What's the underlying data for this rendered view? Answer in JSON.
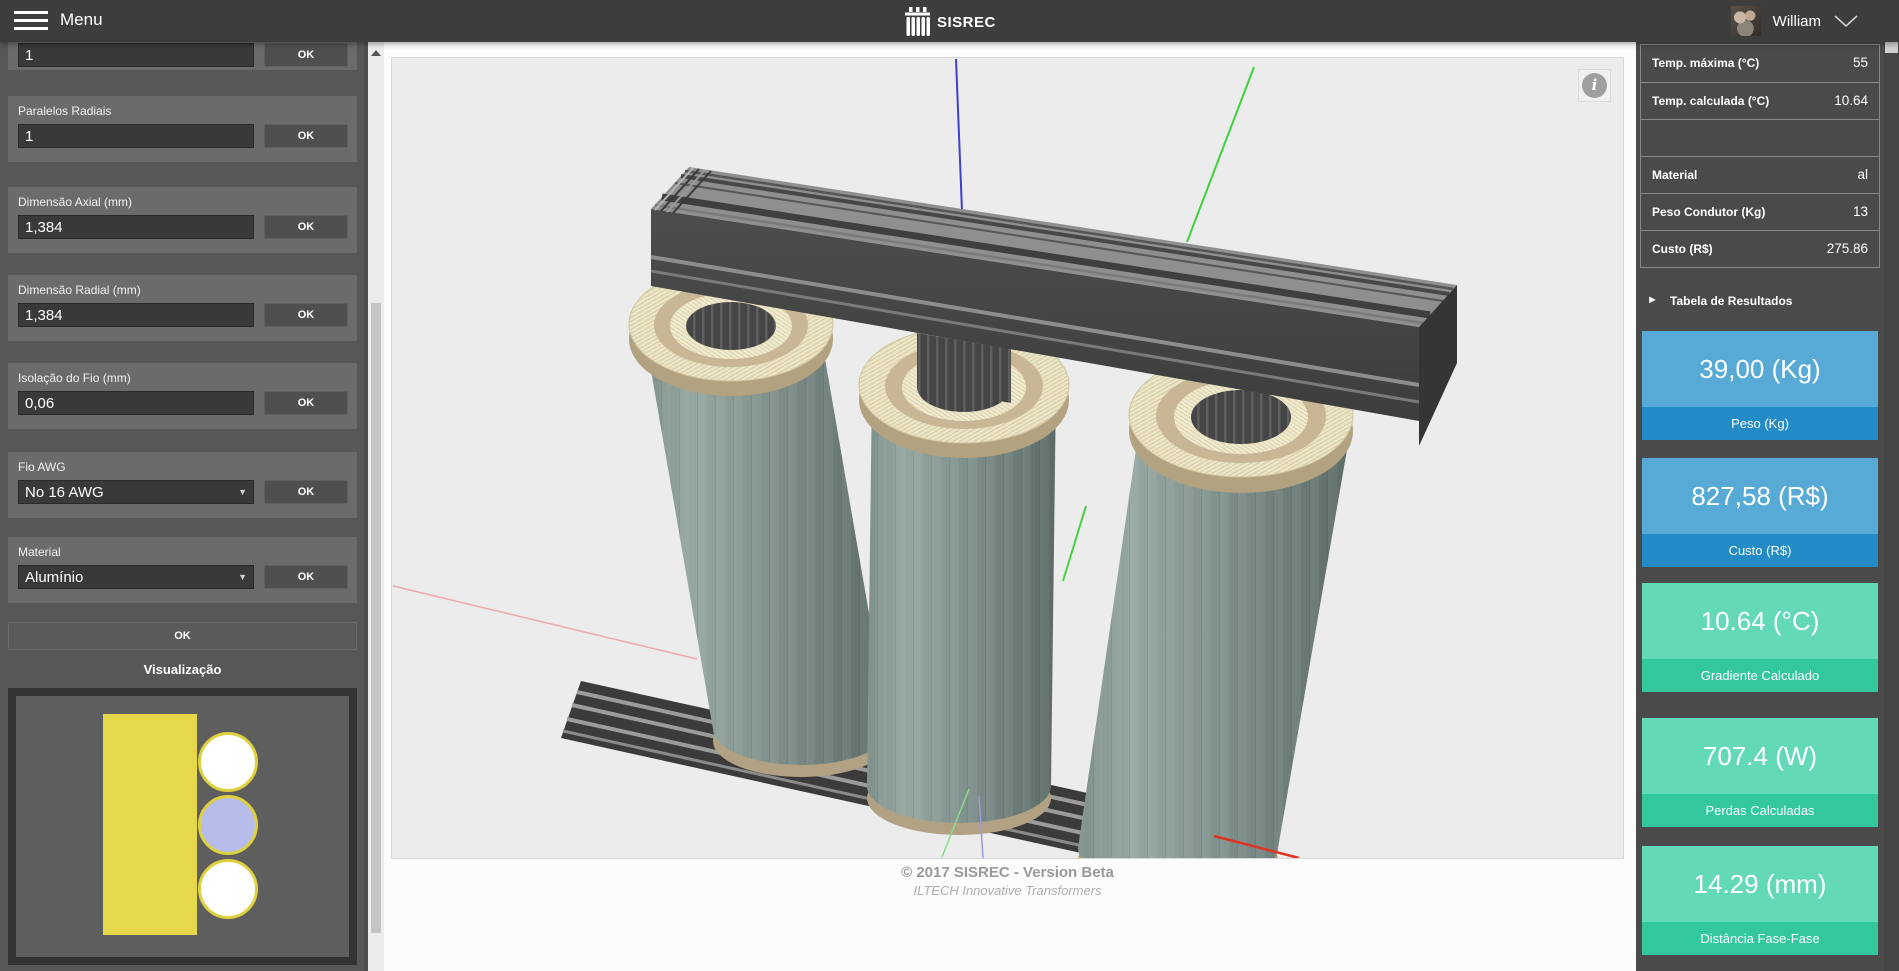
{
  "header": {
    "menu_label": "Menu",
    "app_name": "SISREC",
    "user_name": "William"
  },
  "icons": {
    "caret": "▼",
    "info": "i",
    "results_arrow": "►"
  },
  "sidebar": {
    "groups": [
      {
        "label": "",
        "value": "1"
      },
      {
        "label": "Paralelos Radiais",
        "value": "1"
      },
      {
        "label": "Dimensão Axial (mm)",
        "value": "1,384"
      },
      {
        "label": "Dimensão Radial (mm)",
        "value": "1,384"
      },
      {
        "label": "Isolação do Fio (mm)",
        "value": "0,06"
      },
      {
        "label": "Fio AWG",
        "value": "No 16 AWG"
      },
      {
        "label": "Material",
        "value": "Alumínio"
      }
    ],
    "ok_label": "OK",
    "visualization_title": "Visualização"
  },
  "canvas": {
    "footer_line1": "© 2017 SISREC - Version Beta",
    "footer_line2": "ILTECH Innovative Transformers"
  },
  "results": {
    "toggle_label": "Tabela de Resultados",
    "rows": [
      {
        "label": "Temp. máxima (°C)",
        "value": "55"
      },
      {
        "label": "Temp. calculada (°C)",
        "value": "10.64"
      },
      {
        "label": "",
        "value": ""
      },
      {
        "label": "Material",
        "value": "al"
      },
      {
        "label": "Peso Condutor (Kg)",
        "value": "13"
      },
      {
        "label": "Custo (R$)",
        "value": "275.86"
      }
    ],
    "cards": [
      {
        "value": "39,00 (Kg)",
        "label": "Peso (Kg)",
        "theme": "blue"
      },
      {
        "value": "827,58 (R$)",
        "label": "Custo (R$)",
        "theme": "blue"
      },
      {
        "value": "10.64 (°C)",
        "label": "Gradiente Calculado",
        "theme": "teal"
      },
      {
        "value": "707.4 (W)",
        "label": "Perdas Calculadas",
        "theme": "teal"
      },
      {
        "value": "14.29 (mm)",
        "label": "Distância Fase-Fase",
        "theme": "teal"
      }
    ]
  },
  "colors": {
    "card_blue": "#57aad6",
    "card_blue_dark": "#238bc6",
    "card_teal": "#63d9b8",
    "card_teal_dark": "#32c79c",
    "viz_yellow": "#e5d84b",
    "viz_lavender": "#b7bdeb",
    "header_bg": "#3d3d3d",
    "panel_bg": "#575757"
  }
}
